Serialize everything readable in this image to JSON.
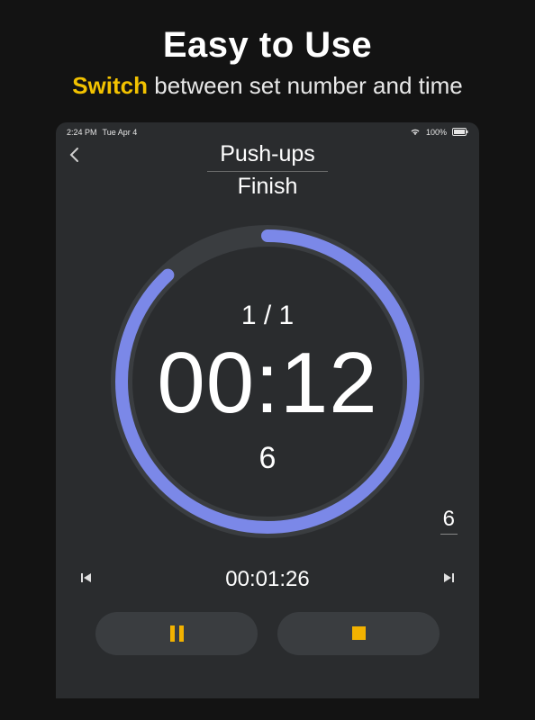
{
  "promo": {
    "title": "Easy to Use",
    "accent": "Switch",
    "rest": " between set number and time"
  },
  "status": {
    "time": "2:24 PM",
    "date": "Tue Apr 4",
    "battery": "100%"
  },
  "header": {
    "exercise": "Push-ups",
    "phase": "Finish"
  },
  "dial": {
    "set_count": "1 / 1",
    "big_time": "00:12",
    "bottom_number": "6",
    "progress_fraction": 0.88
  },
  "right_count": "6",
  "elapsed": "00:01:26",
  "colors": {
    "accent_yellow": "#f2b200",
    "ring": "#7b88e8",
    "ring_track": "#3a3d40"
  }
}
